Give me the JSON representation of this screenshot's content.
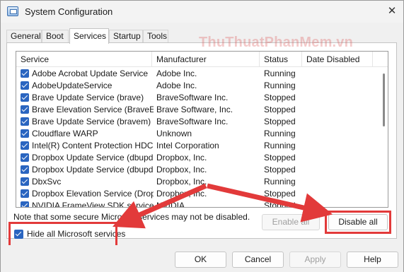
{
  "window": {
    "title": "System Configuration",
    "close_glyph": "✕"
  },
  "tabs": [
    {
      "label": "General",
      "active": false
    },
    {
      "label": "Boot",
      "active": false
    },
    {
      "label": "Services",
      "active": true
    },
    {
      "label": "Startup",
      "active": false
    },
    {
      "label": "Tools",
      "active": false
    }
  ],
  "services_list": {
    "columns": [
      "Service",
      "Manufacturer",
      "Status",
      "Date Disabled"
    ],
    "rows": [
      {
        "service": "Adobe Acrobat Update Service",
        "manufacturer": "Adobe Inc.",
        "status": "Running",
        "checked": true
      },
      {
        "service": "AdobeUpdateService",
        "manufacturer": "Adobe Inc.",
        "status": "Running",
        "checked": true
      },
      {
        "service": "Brave Update Service (brave)",
        "manufacturer": "BraveSoftware Inc.",
        "status": "Stopped",
        "checked": true
      },
      {
        "service": "Brave Elevation Service (BraveEl...",
        "manufacturer": "Brave Software, Inc.",
        "status": "Stopped",
        "checked": true
      },
      {
        "service": "Brave Update Service (bravem)",
        "manufacturer": "BraveSoftware Inc.",
        "status": "Stopped",
        "checked": true
      },
      {
        "service": "Cloudflare WARP",
        "manufacturer": "Unknown",
        "status": "Running",
        "checked": true
      },
      {
        "service": "Intel(R) Content Protection HDC...",
        "manufacturer": "Intel Corporation",
        "status": "Running",
        "checked": true
      },
      {
        "service": "Dropbox Update Service (dbupd...",
        "manufacturer": "Dropbox, Inc.",
        "status": "Stopped",
        "checked": true
      },
      {
        "service": "Dropbox Update Service (dbupd...",
        "manufacturer": "Dropbox, Inc.",
        "status": "Stopped",
        "checked": true
      },
      {
        "service": "DbxSvc",
        "manufacturer": "Dropbox, Inc.",
        "status": "Running",
        "checked": true
      },
      {
        "service": "Dropbox Elevation Service (Drop...",
        "manufacturer": "Dropbox, Inc.",
        "status": "Stopped",
        "checked": true
      },
      {
        "service": "NVIDIA FrameView SDK service",
        "manufacturer": "NVIDIA",
        "status": "Stopped",
        "checked": true
      }
    ]
  },
  "note": "Note that some secure Microsoft services may not be disabled.",
  "buttons": {
    "enable_all": "Enable all",
    "disable_all": "Disable all",
    "ok": "OK",
    "cancel": "Cancel",
    "apply": "Apply",
    "help": "Help"
  },
  "hide_microsoft": {
    "label": "Hide all Microsoft services",
    "checked": true
  },
  "watermark": "ThuThuatPhanMem.vn",
  "colors": {
    "accent": "#2a65c0",
    "annotation_red": "#e23a3a"
  }
}
